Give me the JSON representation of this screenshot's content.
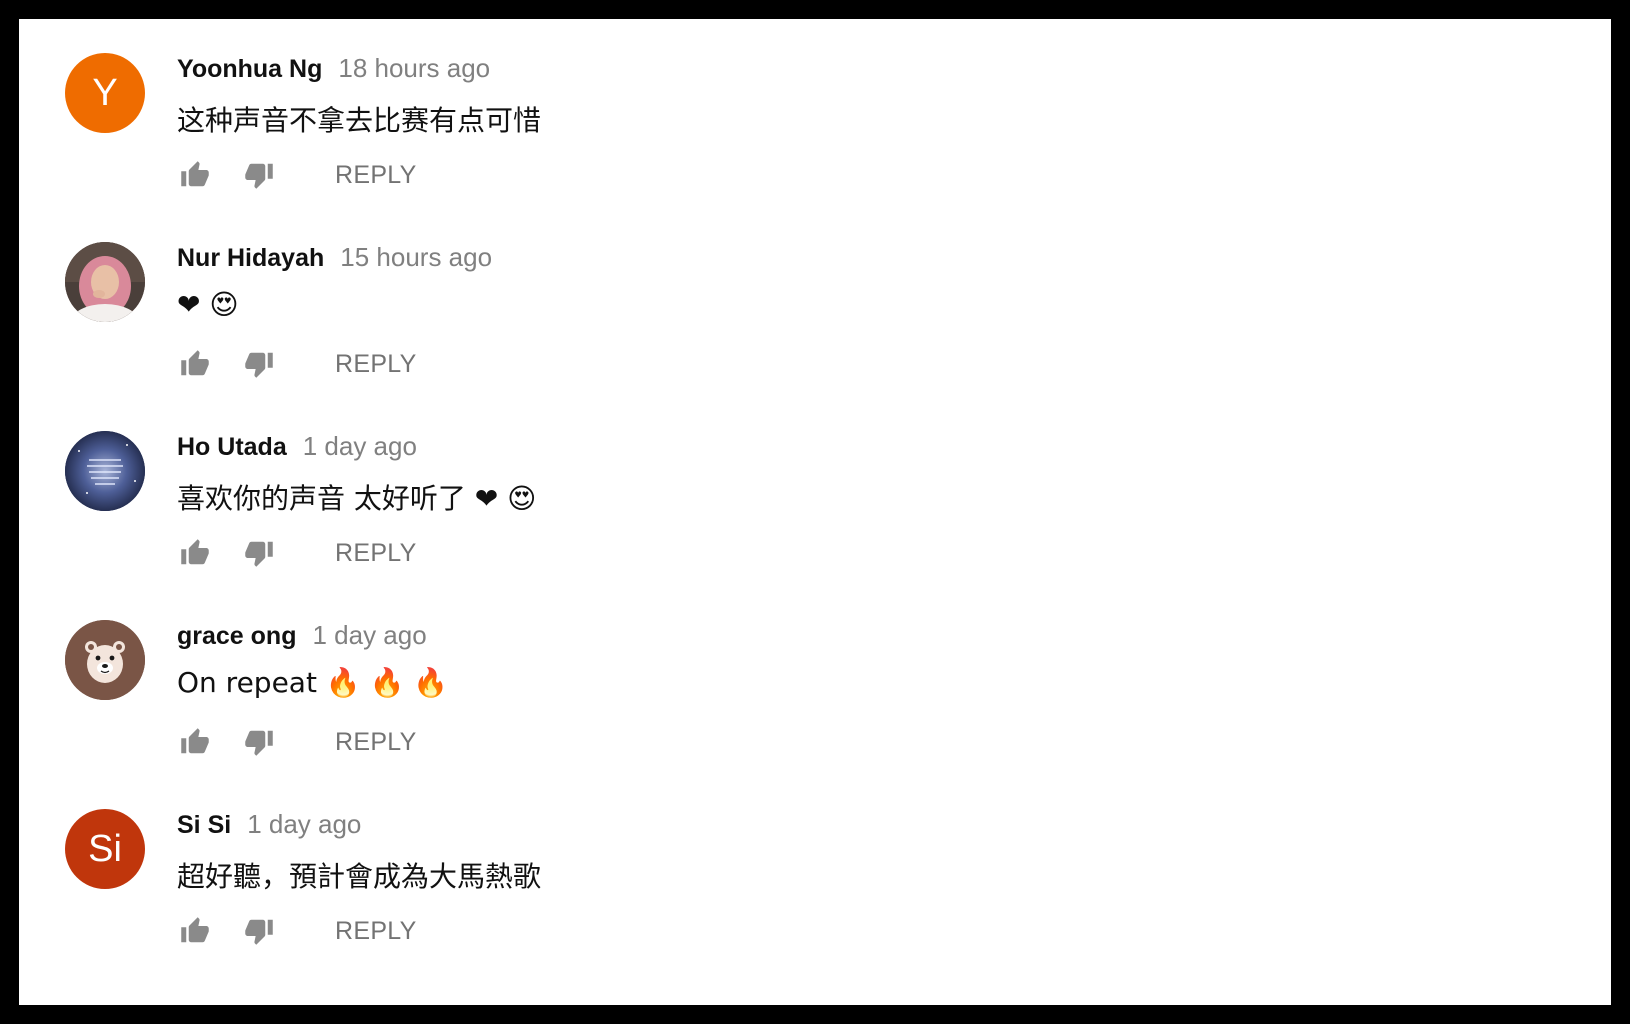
{
  "colors": {
    "author": "#111111",
    "timestamp": "#808080",
    "reply": "#737373",
    "icon": "#8a8a8a",
    "frame": "#000000"
  },
  "comments": [
    {
      "author": "Yoonhua Ng",
      "time": "18 hours ago",
      "text": "这种声音不拿去比赛有点可惜",
      "avatar": {
        "type": "letter",
        "letter": "Y",
        "color": "#ef6c00"
      },
      "reply_label": "REPLY"
    },
    {
      "author": "Nur Hidayah",
      "time": "15 hours ago",
      "text": "❤ 😍",
      "avatar": {
        "type": "photo-hijab",
        "color": "#8c6f64"
      },
      "reply_label": "REPLY"
    },
    {
      "author": "Ho Utada",
      "time": "1 day ago",
      "text": "喜欢你的声音 太好听了 ❤ 😍",
      "avatar": {
        "type": "photo-galaxy",
        "color": "#2b3a6b"
      },
      "reply_label": "REPLY"
    },
    {
      "author": "grace ong",
      "time": "1 day ago",
      "text": "On repeat 🔥 🔥 🔥",
      "avatar": {
        "type": "bear",
        "color": "#795548"
      },
      "reply_label": "REPLY"
    },
    {
      "author": "Si Si",
      "time": "1 day ago",
      "text": "超好聽，預計會成為大馬熱歌",
      "avatar": {
        "type": "letter",
        "letter": "Si",
        "color": "#c0360c"
      },
      "reply_label": "REPLY"
    }
  ]
}
